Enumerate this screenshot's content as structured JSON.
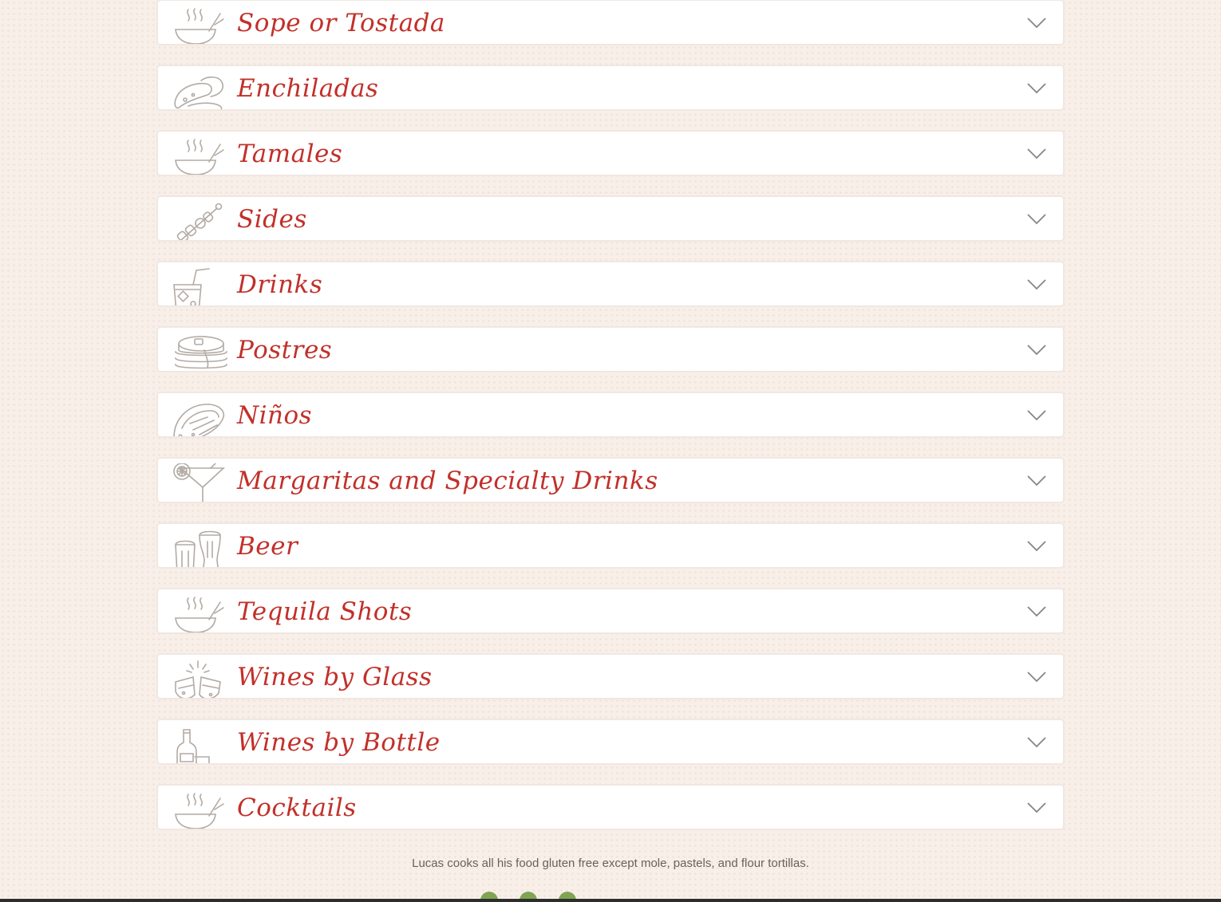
{
  "menu": {
    "categories": [
      {
        "title": "Sope or Tostada",
        "icon": "soup-bowl-icon"
      },
      {
        "title": "Enchiladas",
        "icon": "enchilada-icon"
      },
      {
        "title": "Tamales",
        "icon": "soup-bowl-icon"
      },
      {
        "title": "Sides",
        "icon": "skewer-icon"
      },
      {
        "title": "Drinks",
        "icon": "drink-cup-icon"
      },
      {
        "title": "Postres",
        "icon": "pancakes-icon"
      },
      {
        "title": "Niños",
        "icon": "taco-icon"
      },
      {
        "title": "Margaritas and Specialty Drinks",
        "icon": "margarita-icon"
      },
      {
        "title": "Beer",
        "icon": "beer-glasses-icon"
      },
      {
        "title": "Tequila Shots",
        "icon": "soup-bowl-icon"
      },
      {
        "title": "Wines by Glass",
        "icon": "wine-toast-icon"
      },
      {
        "title": "Wines by Bottle",
        "icon": "wine-bottle-icon"
      },
      {
        "title": "Cocktails",
        "icon": "soup-bowl-icon"
      }
    ]
  },
  "footer": {
    "note": "Lucas cooks all his food gluten free except mole, pastels, and flour tortillas."
  },
  "colors": {
    "background": "#f8efe9",
    "title_red": "#c2302a",
    "icon_gray": "#b3aaa3",
    "legend_green": "#7fa553"
  }
}
